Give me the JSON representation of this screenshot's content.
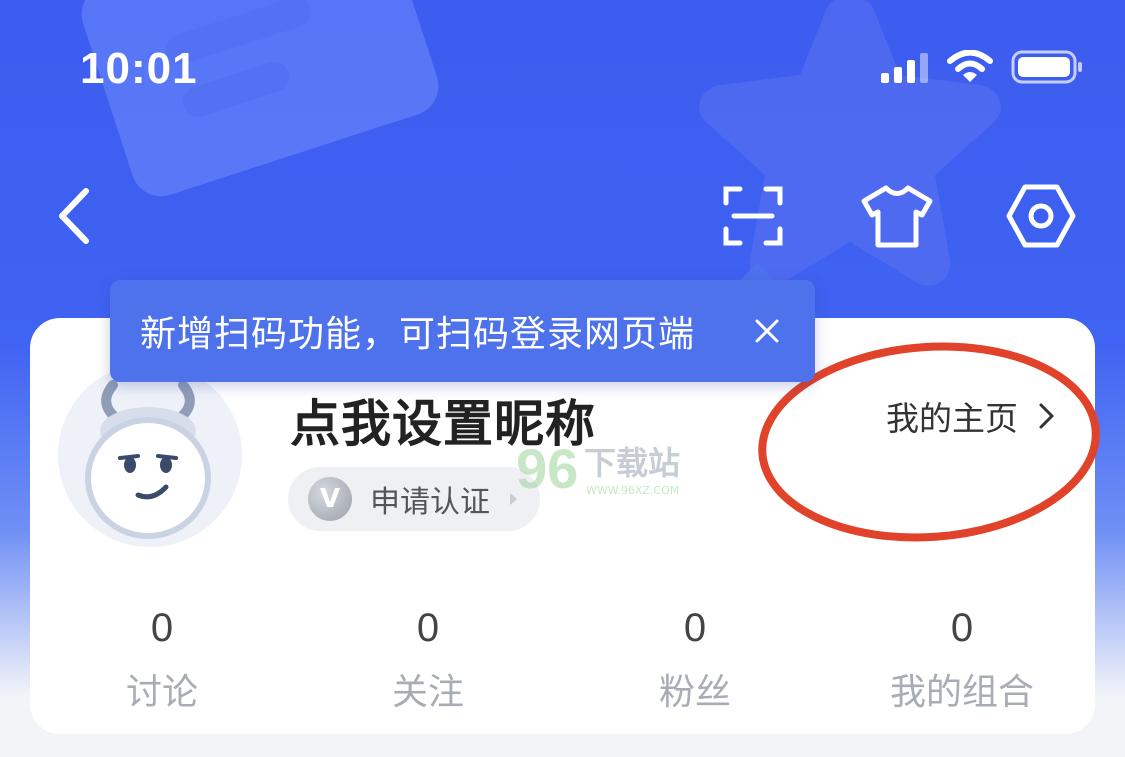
{
  "status_bar": {
    "time": "10:01",
    "icons": [
      "signal-icon",
      "wifi-icon",
      "battery-icon"
    ]
  },
  "nav": {
    "icons": [
      "back-icon",
      "scan-icon",
      "shirt-icon",
      "settings-icon"
    ]
  },
  "tooltip": {
    "text": "新增扫码功能，可扫码登录网页端",
    "close_icon": "close-icon"
  },
  "profile": {
    "nickname": "点我设置昵称",
    "verify_label": "申请认证",
    "verify_badge": "V",
    "home_link": "我的主页"
  },
  "watermark": {
    "text": "下载站",
    "url": "WWW.96XZ.COM"
  },
  "stats": [
    {
      "value": "0",
      "label": "讨论"
    },
    {
      "value": "0",
      "label": "关注"
    },
    {
      "value": "0",
      "label": "粉丝"
    },
    {
      "value": "0",
      "label": "我的组合"
    }
  ],
  "colors": {
    "primary": "#3f63f2",
    "tooltip": "#4d72ec",
    "highlight_circle": "#e0432a"
  }
}
